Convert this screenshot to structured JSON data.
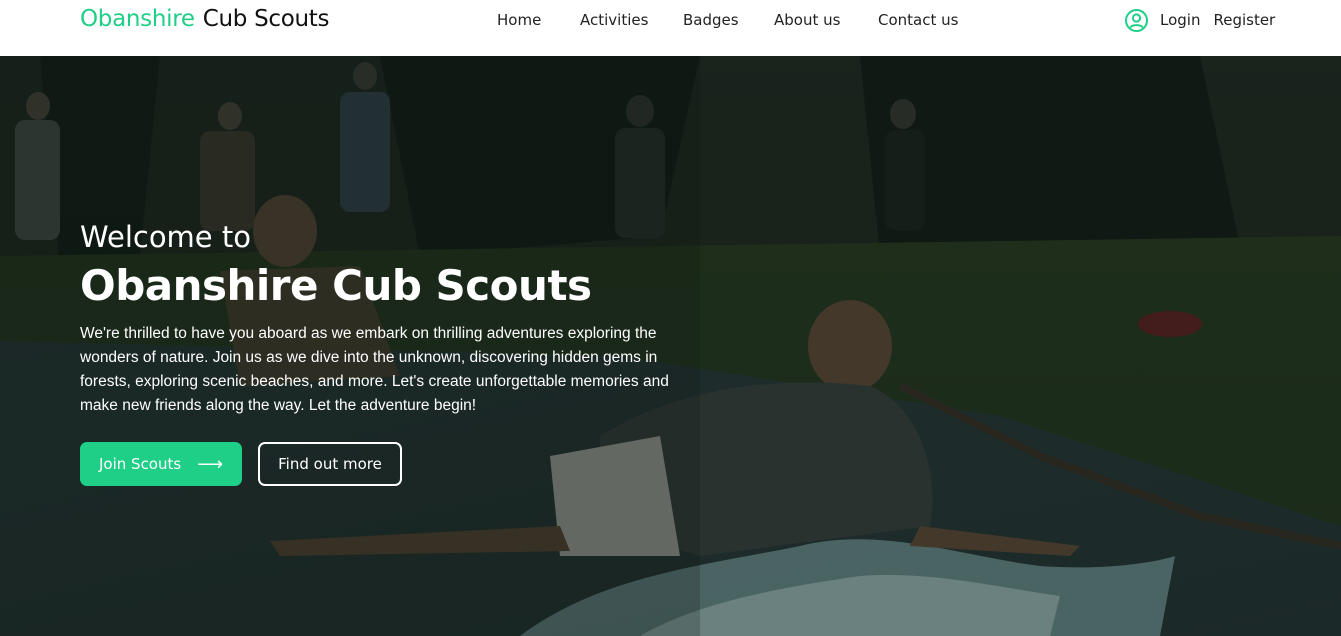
{
  "header": {
    "brand_primary": "Obanshire",
    "brand_secondary": "Cub Scouts",
    "nav": {
      "home": "Home",
      "activities": "Activities",
      "badges": "Badges",
      "about": "About us",
      "contact": "Contact us"
    },
    "account": {
      "icon": "user-circle-icon",
      "login": "Login",
      "register": "Register"
    }
  },
  "hero": {
    "welcome": "Welcome to",
    "title": "Obanshire Cub Scouts",
    "intro": "We're thrilled to have you aboard as we embark on thrilling adventures exploring the wonders of nature. Join us as we dive into the unknown, discovering hidden gems in forests, exploring scenic beaches, and more. Let's create unforgettable memories and make new friends along the way. Let the adventure begin!",
    "join_button": "Join Scouts",
    "join_arrow": "⟶",
    "more_button": "Find out more"
  },
  "colors": {
    "accent": "#1fcf87",
    "text_dark": "#111111",
    "hero_overlay": "#0f1a14"
  }
}
